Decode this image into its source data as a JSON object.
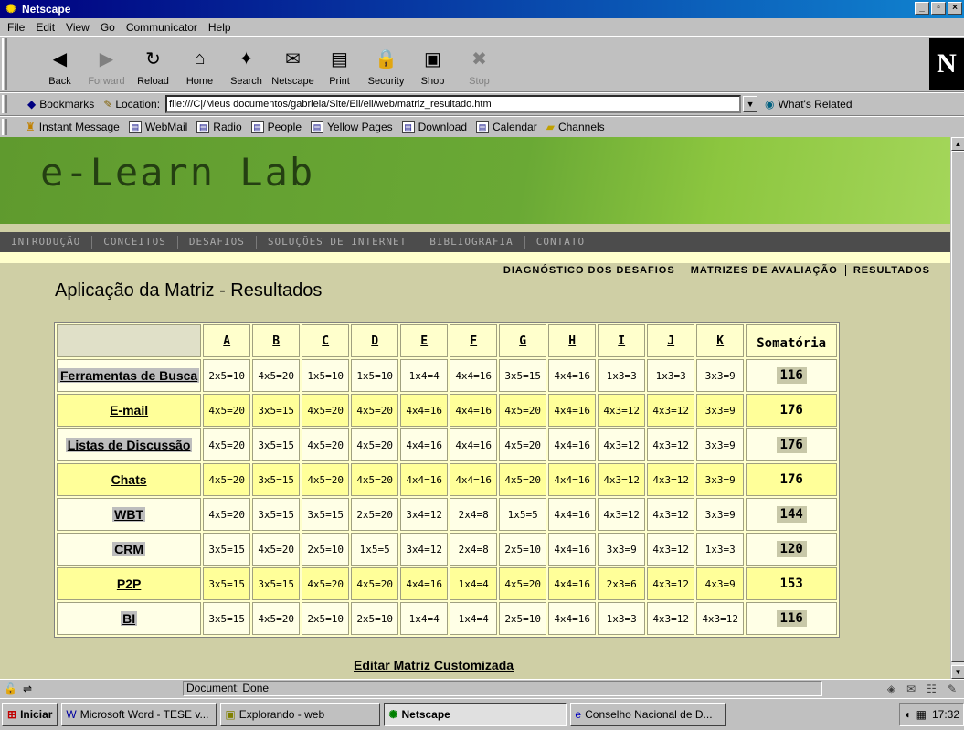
{
  "window": {
    "title": "Netscape",
    "buttons": [
      "_",
      "▫",
      "×"
    ]
  },
  "menu": [
    "File",
    "Edit",
    "View",
    "Go",
    "Communicator",
    "Help"
  ],
  "nav_toolbar": [
    {
      "label": "Back",
      "icon": "back-arrow-icon",
      "glyph": "◀",
      "enabled": true
    },
    {
      "label": "Forward",
      "icon": "forward-arrow-icon",
      "glyph": "▶",
      "enabled": false
    },
    {
      "label": "Reload",
      "icon": "reload-icon",
      "glyph": "↻",
      "enabled": true
    },
    {
      "label": "Home",
      "icon": "home-icon",
      "glyph": "⌂",
      "enabled": true
    },
    {
      "label": "Search",
      "icon": "search-icon",
      "glyph": "✦",
      "enabled": true
    },
    {
      "label": "Netscape",
      "icon": "netscape-icon",
      "glyph": "✉",
      "enabled": true
    },
    {
      "label": "Print",
      "icon": "print-icon",
      "glyph": "▤",
      "enabled": true
    },
    {
      "label": "Security",
      "icon": "lock-icon",
      "glyph": "🔒",
      "enabled": true
    },
    {
      "label": "Shop",
      "icon": "shop-icon",
      "glyph": "▣",
      "enabled": true
    },
    {
      "label": "Stop",
      "icon": "stop-icon",
      "glyph": "✖",
      "enabled": false
    }
  ],
  "location_bar": {
    "bookmarks_label": "Bookmarks",
    "location_label": "Location:",
    "url": "file:///C|/Meus documentos/gabriela/Site/Ell/ell/web/matriz_resultado.htm",
    "whats_related": "What's Related"
  },
  "personal_toolbar": [
    "Instant Message",
    "WebMail",
    "Radio",
    "People",
    "Yellow Pages",
    "Download",
    "Calendar",
    "Channels"
  ],
  "site": {
    "banner_title": "e-Learn Lab",
    "nav": [
      "INTRODUÇÃO",
      "CONCEITOS",
      "DESAFIOS",
      "SOLUÇÕES DE INTERNET",
      "BIBLIOGRAFIA",
      "CONTATO"
    ],
    "subnav": [
      "DIAGNÓSTICO DOS DESAFIOS",
      "MATRIZES DE AVALIAÇÃO",
      "RESULTADOS"
    ],
    "page_title": "Aplicação da Matriz - Resultados",
    "edit_link": "Editar Matriz Customizada"
  },
  "matrix": {
    "columns": [
      "A",
      "B",
      "C",
      "D",
      "E",
      "F",
      "G",
      "H",
      "I",
      "J",
      "K"
    ],
    "sum_header": "Somatória",
    "rows": [
      {
        "label": "Ferramentas de Busca",
        "cells": [
          "2x5=10",
          "4x5=20",
          "1x5=10",
          "1x5=10",
          "1x4=4",
          "4x4=16",
          "3x5=15",
          "4x4=16",
          "1x3=3",
          "1x3=3",
          "3x3=9"
        ],
        "sum": "116",
        "style": "white"
      },
      {
        "label": "E-mail",
        "cells": [
          "4x5=20",
          "3x5=15",
          "4x5=20",
          "4x5=20",
          "4x4=16",
          "4x4=16",
          "4x5=20",
          "4x4=16",
          "4x3=12",
          "4x3=12",
          "3x3=9"
        ],
        "sum": "176",
        "style": "yellow"
      },
      {
        "label": "Listas de Discussão",
        "cells": [
          "4x5=20",
          "3x5=15",
          "4x5=20",
          "4x5=20",
          "4x4=16",
          "4x4=16",
          "4x5=20",
          "4x4=16",
          "4x3=12",
          "4x3=12",
          "3x3=9"
        ],
        "sum": "176",
        "style": "white"
      },
      {
        "label": "Chats",
        "cells": [
          "4x5=20",
          "3x5=15",
          "4x5=20",
          "4x5=20",
          "4x4=16",
          "4x4=16",
          "4x5=20",
          "4x4=16",
          "4x3=12",
          "4x3=12",
          "3x3=9"
        ],
        "sum": "176",
        "style": "yellow"
      },
      {
        "label": "WBT",
        "cells": [
          "4x5=20",
          "3x5=15",
          "3x5=15",
          "2x5=20",
          "3x4=12",
          "2x4=8",
          "1x5=5",
          "4x4=16",
          "4x3=12",
          "4x3=12",
          "3x3=9"
        ],
        "sum": "144",
        "style": "white"
      },
      {
        "label": "CRM",
        "cells": [
          "3x5=15",
          "4x5=20",
          "2x5=10",
          "1x5=5",
          "3x4=12",
          "2x4=8",
          "2x5=10",
          "4x4=16",
          "3x3=9",
          "4x3=12",
          "1x3=3"
        ],
        "sum": "120",
        "style": "white"
      },
      {
        "label": "P2P",
        "cells": [
          "3x5=15",
          "3x5=15",
          "4x5=20",
          "4x5=20",
          "4x4=16",
          "1x4=4",
          "4x5=20",
          "4x4=16",
          "2x3=6",
          "4x3=12",
          "4x3=9"
        ],
        "sum": "153",
        "style": "yellow"
      },
      {
        "label": "BI",
        "cells": [
          "3x5=15",
          "4x5=20",
          "2x5=10",
          "2x5=10",
          "1x4=4",
          "1x4=4",
          "2x5=10",
          "4x4=16",
          "1x3=3",
          "4x3=12",
          "4x3=12"
        ],
        "sum": "116",
        "style": "white"
      }
    ]
  },
  "status": {
    "text": "Document: Done"
  },
  "taskbar": {
    "start": "Iniciar",
    "tasks": [
      {
        "label": "Microsoft Word - TESE v...",
        "active": false
      },
      {
        "label": "Explorando - web",
        "active": false
      },
      {
        "label": "Netscape",
        "active": true
      },
      {
        "label": "Conselho Nacional de D...",
        "active": false
      }
    ],
    "clock": "17:32"
  }
}
